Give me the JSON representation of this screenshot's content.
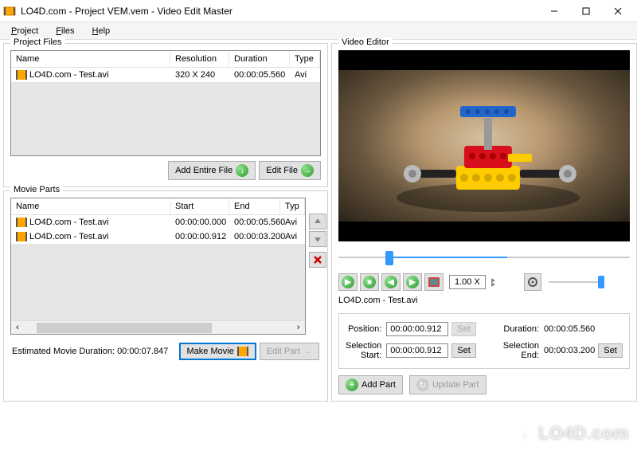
{
  "window": {
    "title": "LO4D.com - Project VEM.vem - Video Edit Master"
  },
  "menu": {
    "project": "Project",
    "files": "Files",
    "help": "Help"
  },
  "projectFiles": {
    "title": "Project Files",
    "headers": {
      "name": "Name",
      "resolution": "Resolution",
      "duration": "Duration",
      "type": "Type"
    },
    "rows": [
      {
        "name": "LO4D.com - Test.avi",
        "resolution": "320 X 240",
        "duration": "00:00:05.560",
        "type": "Avi"
      }
    ],
    "addEntireFile": "Add Entire File",
    "editFile": "Edit File"
  },
  "movieParts": {
    "title": "Movie Parts",
    "headers": {
      "name": "Name",
      "start": "Start",
      "end": "End",
      "type": "Typ"
    },
    "rows": [
      {
        "name": "LO4D.com - Test.avi",
        "start": "00:00:00.000",
        "end": "00:00:05.560",
        "type": "Avi"
      },
      {
        "name": "LO4D.com - Test.avi",
        "start": "00:00:00.912",
        "end": "00:00:03.200",
        "type": "Avi"
      }
    ],
    "estimatedLabel": "Estimated Movie Duration:",
    "estimatedValue": "00:00:07.847",
    "makeMovie": "Make Movie",
    "editPart": "Edit Part"
  },
  "videoEditor": {
    "title": "Video Editor",
    "speed": "1.00 X",
    "currentFile": "LO4D.com - Test.avi",
    "positionLabel": "Position:",
    "positionValue": "00:00:00.912",
    "selStartLabel": "Selection Start:",
    "selStartValue": "00:00:00.912",
    "durationLabel": "Duration:",
    "durationValue": "00:00:05.560",
    "selEndLabel": "Selection End:",
    "selEndValue": "00:00:03.200",
    "set": "Set",
    "addPart": "Add Part",
    "updatePart": "Update Part"
  },
  "watermark": "LO4D.com"
}
